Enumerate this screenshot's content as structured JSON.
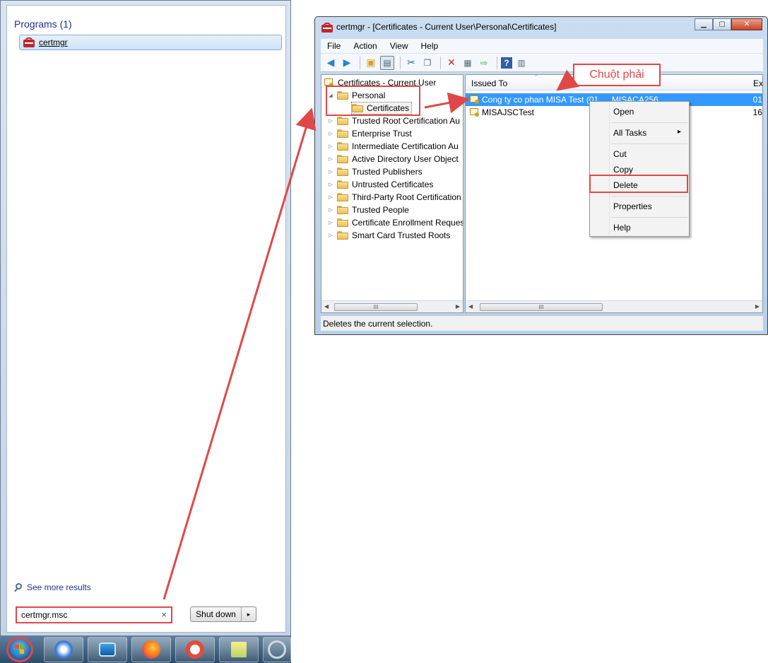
{
  "start_menu": {
    "programs_header": "Programs (1)",
    "program_item": "certmgr",
    "see_more": "See more results",
    "search_value": "certmgr.msc",
    "search_clear": "×",
    "shutdown_label": "Shut down",
    "shutdown_arrow": "▸"
  },
  "window": {
    "title": "certmgr - [Certificates - Current User\\Personal\\Certificates]",
    "controls": {
      "minimize": "▁",
      "maximize": "▢",
      "close": "✕"
    },
    "menu": [
      "File",
      "Action",
      "View",
      "Help"
    ],
    "tree": {
      "root": "Certificates - Current User",
      "items": [
        "Personal",
        "Certificates",
        "Trusted Root Certification Au",
        "Enterprise Trust",
        "Intermediate Certification Au",
        "Active Directory User Object",
        "Trusted Publishers",
        "Untrusted Certificates",
        "Third-Party Root Certification",
        "Trusted People",
        "Certificate Enrollment Reques",
        "Smart Card Trusted Roots"
      ]
    },
    "columns": {
      "issued_to": "Issued To",
      "expiry": "Ex"
    },
    "rows": [
      {
        "issued_to": "Cong ty co phan MISA Test (01...",
        "issued_by": "MISACA256",
        "expiry": "01"
      },
      {
        "issued_to": "MISAJSCTest",
        "issued_by": "",
        "expiry": "16"
      }
    ],
    "scroll_grip": "III",
    "status": "Deletes the current selection."
  },
  "context_menu": {
    "items": [
      "Open",
      "All Tasks",
      "Cut",
      "Copy",
      "Delete",
      "Properties",
      "Help"
    ],
    "submenu_arrow": "▸"
  },
  "annotation": {
    "callout": "Chuột phải",
    "color": "#e04848"
  }
}
